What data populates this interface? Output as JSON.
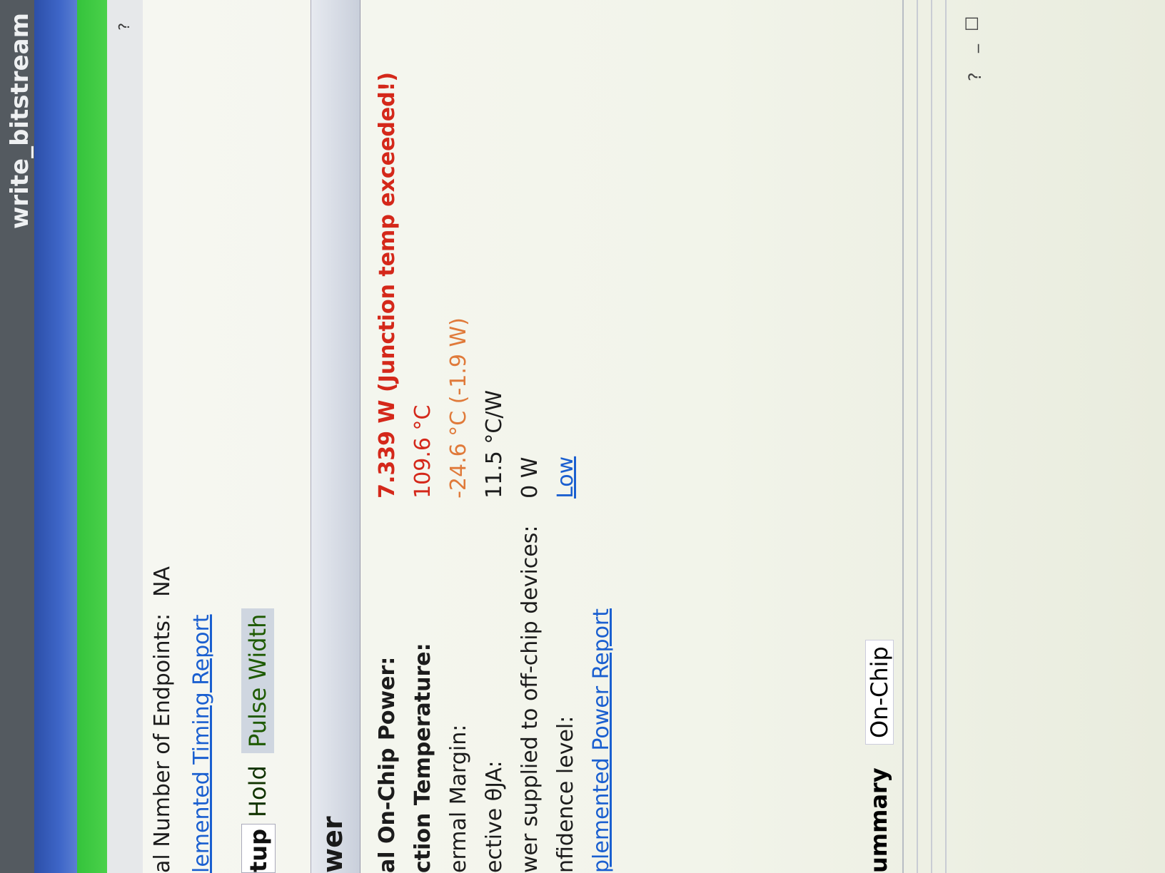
{
  "window": {
    "title": "write_bitstream",
    "help": "?"
  },
  "timing": {
    "endpoints_label": "al Number of Endpoints:",
    "endpoints_value": "NA",
    "report_link": "lemented Timing Report",
    "tabs": [
      "tup",
      "Hold",
      "Pulse Width"
    ]
  },
  "power": {
    "section_title": "wer",
    "rows": [
      {
        "label": "al On-Chip Power:",
        "value": "7.339 W (Junction temp exceeded!)"
      },
      {
        "label": "ction Temperature:",
        "value": "109.6 °C"
      },
      {
        "label": "ermal Margin:",
        "value": "-24.6 °C (-1.9 W)"
      },
      {
        "label": "ective θJA:",
        "value": "11.5 °C/W"
      },
      {
        "label": "wer supplied to off-chip devices:",
        "value": "0 W"
      },
      {
        "label": "nfidence level:",
        "value": "Low"
      }
    ],
    "report_link": "plemented Power Report"
  },
  "bottom_tabs": [
    "ummary",
    "On-Chip"
  ],
  "window_controls": {
    "help": "?",
    "minimize": "_",
    "maximize": "☐"
  },
  "colors": {
    "warning_red": "#d4281a",
    "margin_orange": "#e07a3a",
    "link_blue": "#1a5fd0"
  }
}
